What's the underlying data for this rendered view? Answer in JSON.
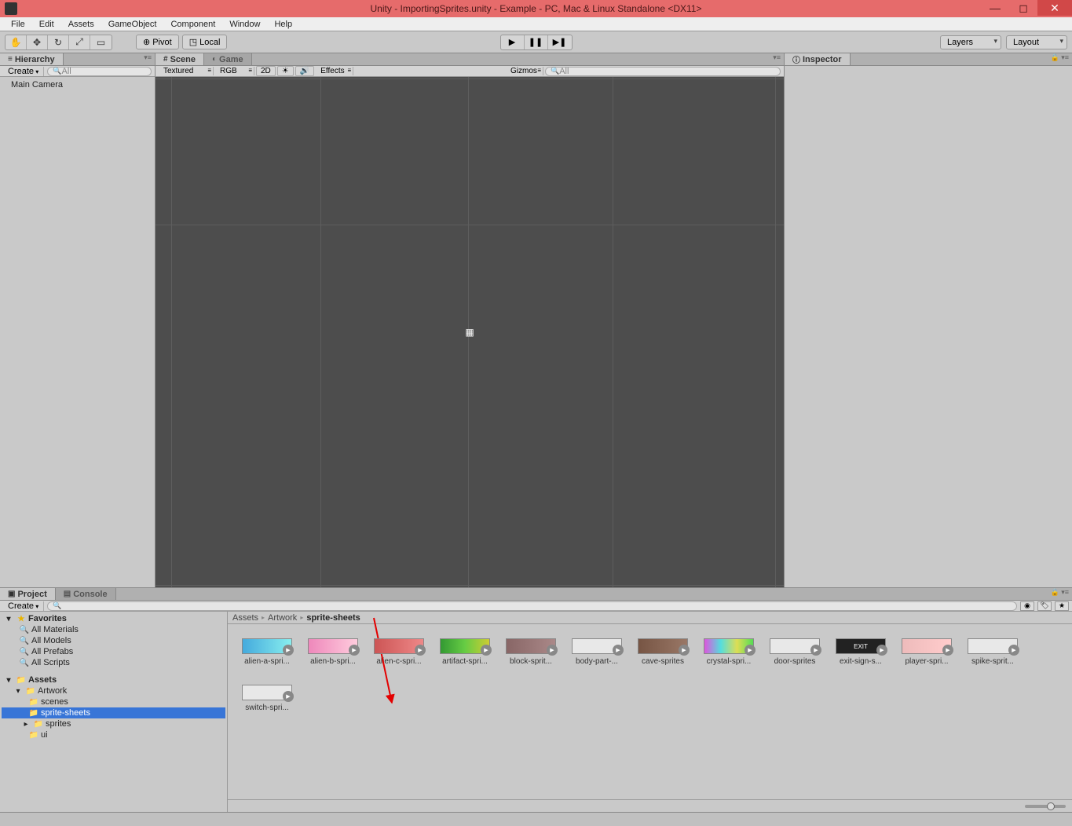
{
  "window": {
    "title": "Unity - ImportingSprites.unity - Example - PC, Mac & Linux Standalone <DX11>"
  },
  "menubar": [
    "File",
    "Edit",
    "Assets",
    "GameObject",
    "Component",
    "Window",
    "Help"
  ],
  "toolbar": {
    "pivot": "Pivot",
    "local": "Local",
    "layers": "Layers",
    "layout": "Layout"
  },
  "hierarchy": {
    "tab": "Hierarchy",
    "create": "Create",
    "search_placeholder": "All",
    "items": [
      "Main Camera"
    ]
  },
  "scene": {
    "tab": "Scene",
    "game_tab": "Game",
    "shaded": "Textured",
    "rgb": "RGB",
    "mode2d": "2D",
    "effects": "Effects",
    "gizmos": "Gizmos",
    "search_placeholder": "All"
  },
  "inspector": {
    "tab": "Inspector"
  },
  "project": {
    "tab": "Project",
    "console_tab": "Console",
    "create": "Create",
    "favorites": {
      "label": "Favorites",
      "items": [
        "All Materials",
        "All Models",
        "All Prefabs",
        "All Scripts"
      ]
    },
    "assets": {
      "label": "Assets",
      "tree": [
        {
          "name": "Artwork",
          "depth": 1,
          "expanded": true
        },
        {
          "name": "scenes",
          "depth": 2,
          "expanded": false
        },
        {
          "name": "sprite-sheets",
          "depth": 2,
          "expanded": false,
          "selected": true
        },
        {
          "name": "sprites",
          "depth": 1,
          "expanded": false,
          "arrow": true
        },
        {
          "name": "ui",
          "depth": 1,
          "expanded": false
        }
      ]
    },
    "breadcrumb": [
      "Assets",
      "Artwork",
      "sprite-sheets"
    ],
    "grid": [
      "alien-a-spri...",
      "alien-b-spri...",
      "alien-c-spri...",
      "artifact-spri...",
      "block-sprit...",
      "body-part-...",
      "cave-sprites",
      "crystal-spri...",
      "door-sprites",
      "exit-sign-s...",
      "player-spri...",
      "spike-sprit...",
      "switch-spri..."
    ]
  }
}
